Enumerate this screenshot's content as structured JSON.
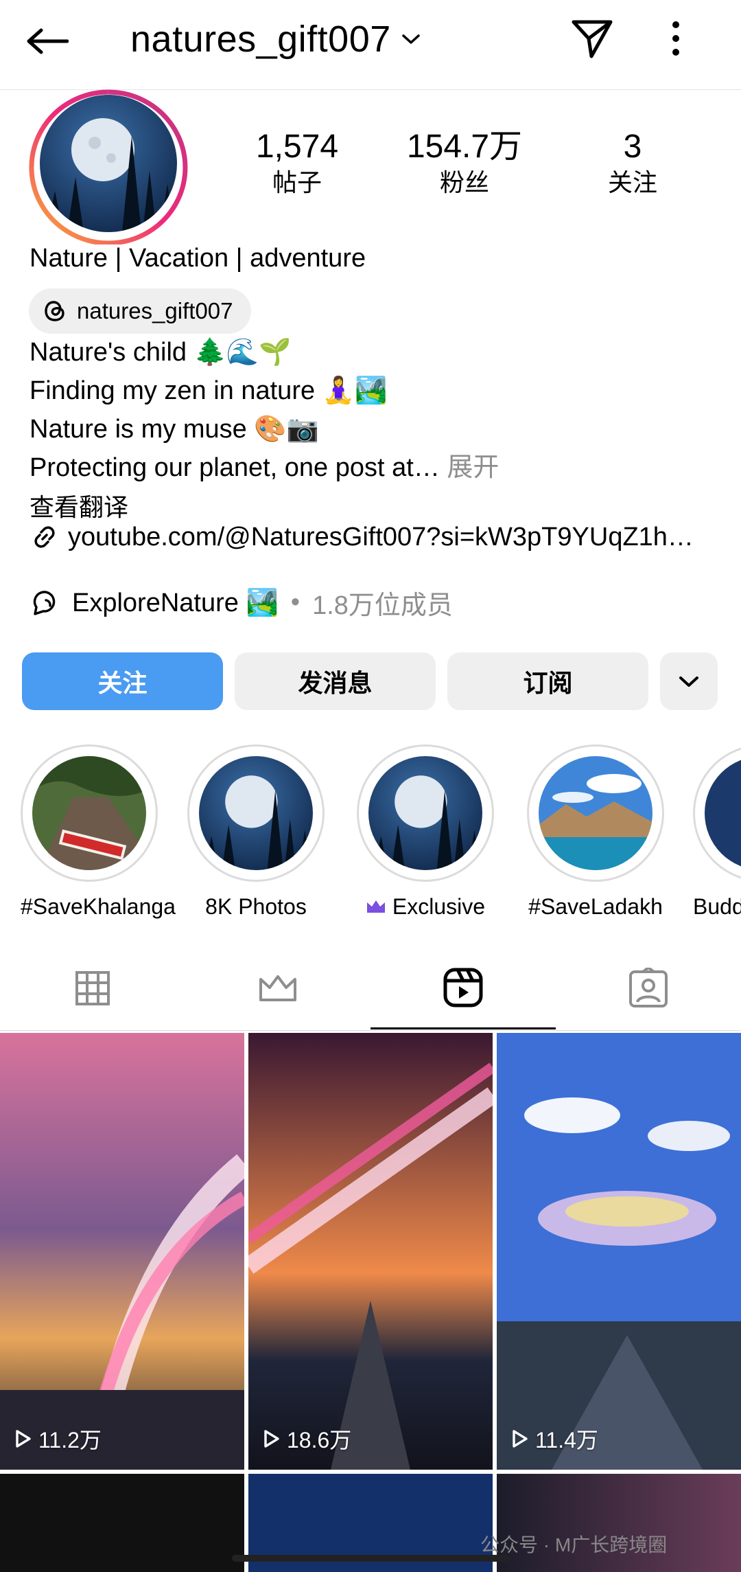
{
  "header": {
    "username": "natures_gift007",
    "back_icon": "arrow-left-icon",
    "send_icon": "send-icon",
    "more_icon": "more-vertical-icon"
  },
  "stats": [
    {
      "num": "1,574",
      "label": "帖子"
    },
    {
      "num": "154.7万",
      "label": "粉丝"
    },
    {
      "num": "3",
      "label": "关注"
    }
  ],
  "bio": {
    "name": "Nature | Vacation | adventure",
    "threads_handle": "natures_gift007",
    "lines": [
      "Nature's child 🌲🌊🌱",
      "Finding my zen in nature 🧘‍♀️🏞️",
      "Nature is my muse 🎨📷",
      "Protecting our planet, one post at…"
    ],
    "more": "展开",
    "translate": "查看翻译",
    "link": "youtube.com/@NaturesGift007?si=kW3pT9YUqZ1h…"
  },
  "channel": {
    "name": "ExploreNature 🏞️",
    "dot": "•",
    "members": "1.8万位成员"
  },
  "buttons": {
    "follow": "关注",
    "message": "发消息",
    "subscribe": "订阅"
  },
  "highlights": [
    {
      "label": "#SaveKhalanga"
    },
    {
      "label": "8K Photos"
    },
    {
      "label": "Exclusive"
    },
    {
      "label": "#SaveLadakh"
    },
    {
      "label": "Budd"
    }
  ],
  "reels": [
    {
      "views": "11.2万"
    },
    {
      "views": "18.6万"
    },
    {
      "views": "11.4万"
    }
  ],
  "watermark": "公众号 · M广长跨境圈",
  "colors": {
    "accent": "#4a9bf2",
    "muted": "#8e8e8e",
    "chip": "#efefef"
  }
}
